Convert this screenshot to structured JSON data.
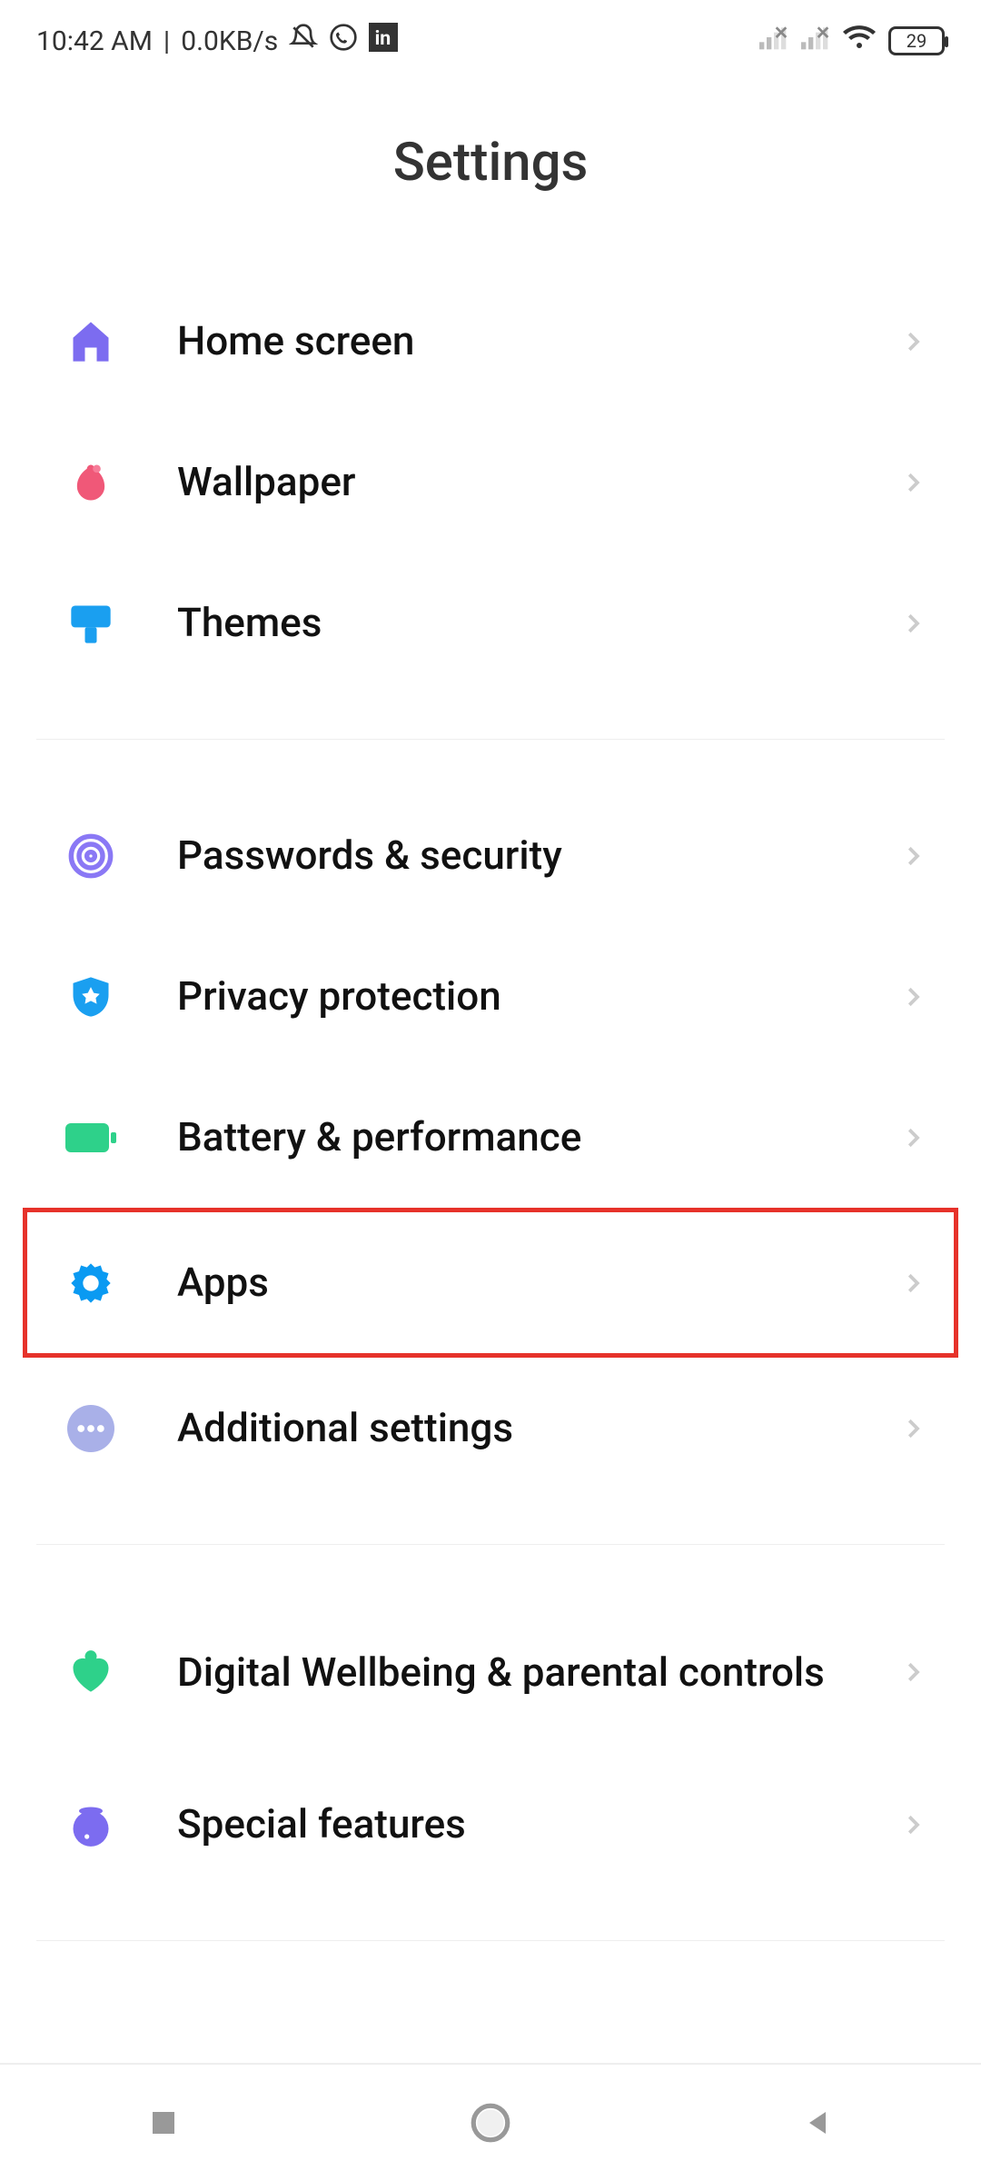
{
  "status": {
    "time": "10:42 AM",
    "net_speed": "0.0KB/s",
    "battery_level": "29"
  },
  "title": "Settings",
  "groups": [
    {
      "items": [
        {
          "key": "home",
          "label": "Home screen",
          "icon": "home-icon",
          "color": "#7c6cf0"
        },
        {
          "key": "wallpaper",
          "label": "Wallpaper",
          "icon": "wallpaper-icon",
          "color": "#f05878"
        },
        {
          "key": "themes",
          "label": "Themes",
          "icon": "themes-icon",
          "color": "#1a9ff0"
        }
      ]
    },
    {
      "items": [
        {
          "key": "passwords",
          "label": "Passwords & security",
          "icon": "fingerprint-icon",
          "color": "#8a78f5"
        },
        {
          "key": "privacy",
          "label": "Privacy protection",
          "icon": "shield-icon",
          "color": "#1a9ff0"
        },
        {
          "key": "battery",
          "label": "Battery & performance",
          "icon": "battery-icon",
          "color": "#2ed18a"
        },
        {
          "key": "apps",
          "label": "Apps",
          "icon": "apps-gear-icon",
          "color": "#0a9af2",
          "highlighted": true
        },
        {
          "key": "additional",
          "label": "Additional settings",
          "icon": "more-circle-icon",
          "color": "#a9b0e8"
        }
      ]
    },
    {
      "items": [
        {
          "key": "wellbeing",
          "label": "Digital Wellbeing & parental controls",
          "icon": "heart-icon",
          "color": "#2ed18a"
        },
        {
          "key": "special",
          "label": "Special features",
          "icon": "flask-icon",
          "color": "#7c6cf0"
        }
      ]
    }
  ]
}
